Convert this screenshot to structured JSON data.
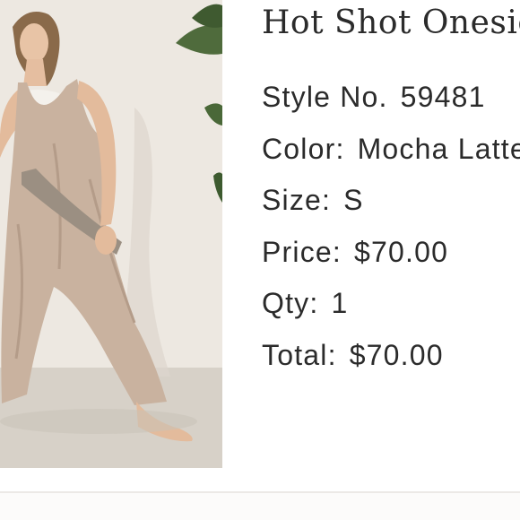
{
  "product": {
    "title": "Hot Shot Onesie",
    "style": {
      "label": "Style No.",
      "value": "59481"
    },
    "color": {
      "label": "Color:",
      "value": "Mocha Latte"
    },
    "size": {
      "label": "Size:",
      "value": "S"
    },
    "price": {
      "label": "Price:",
      "value": "$70.00"
    },
    "qty": {
      "label": "Qty:",
      "value": "1"
    },
    "total": {
      "label": "Total:",
      "value": "$70.00"
    }
  },
  "colors": {
    "text": "#2b2b2b",
    "photo_background": "#ebe6df",
    "garment": "#c9b29f",
    "divider": "#ece9e6"
  }
}
